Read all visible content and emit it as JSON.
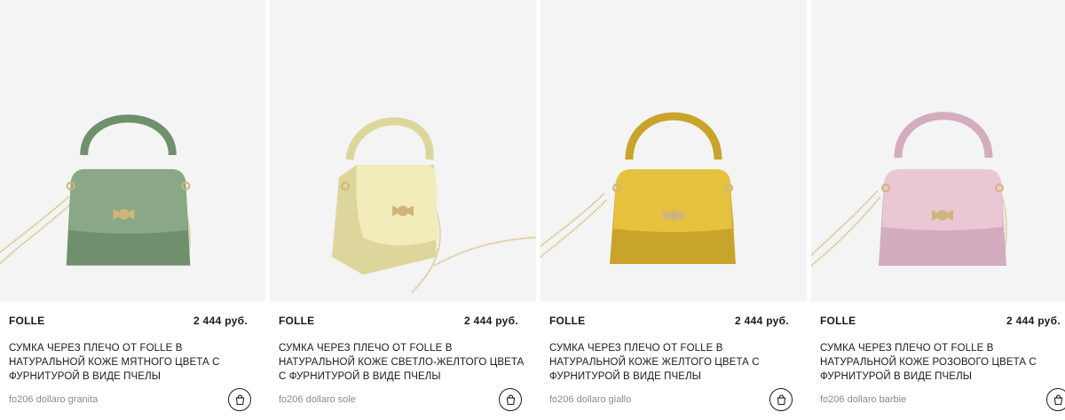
{
  "products": [
    {
      "brand": "FOLLE",
      "price": "2 444 руб.",
      "description": "СУМКА ЧЕРЕЗ ПЛЕЧО ОТ FOLLE В НАТУРАЛЬНОЙ КОЖЕ МЯТНОГО ЦВЕТА С ФУРНИТУРОЙ В ВИДЕ ПЧЕЛЫ",
      "sku": "fo206 dollaro granita",
      "bag_color": "#8aa887",
      "bag_shade": "#6f8f6d",
      "cart_icon": "shopping-bag-icon"
    },
    {
      "brand": "FOLLE",
      "price": "2 444 руб.",
      "description": "СУМКА ЧЕРЕЗ ПЛЕЧО ОТ FOLLE В НАТУРАЛЬНОЙ КОЖЕ СВЕТЛО-ЖЕЛТОГО ЦВЕТА С ФУРНИТУРОЙ В ВИДЕ ПЧЕЛЫ",
      "sku": "fo206 dollaro sole",
      "bag_color": "#f1ecb9",
      "bag_shade": "#ddd69c",
      "cart_icon": "shopping-bag-icon"
    },
    {
      "brand": "FOLLE",
      "price": "2 444 руб.",
      "description": "СУМКА ЧЕРЕЗ ПЛЕЧО ОТ FOLLE В НАТУРАЛЬНОЙ КОЖЕ ЖЕЛТОГО ЦВЕТА С ФУРНИТУРОЙ В ВИДЕ ПЧЕЛЫ",
      "sku": "fo206 dollaro giallo",
      "bag_color": "#e6c13e",
      "bag_shade": "#c9a42a",
      "cart_icon": "shopping-bag-icon"
    },
    {
      "brand": "FOLLE",
      "price": "2 444 руб.",
      "description": "СУМКА ЧЕРЕЗ ПЛЕЧО ОТ FOLLE В НАТУРАЛЬНОЙ КОЖЕ РОЗОВОГО ЦВЕТА С ФУРНИТУРОЙ В ВИДЕ ПЧЕЛЫ",
      "sku": "fo206 dollaro barbie",
      "bag_color": "#e9c7d5",
      "bag_shade": "#d3acbe",
      "cart_icon": "shopping-bag-icon"
    }
  ]
}
